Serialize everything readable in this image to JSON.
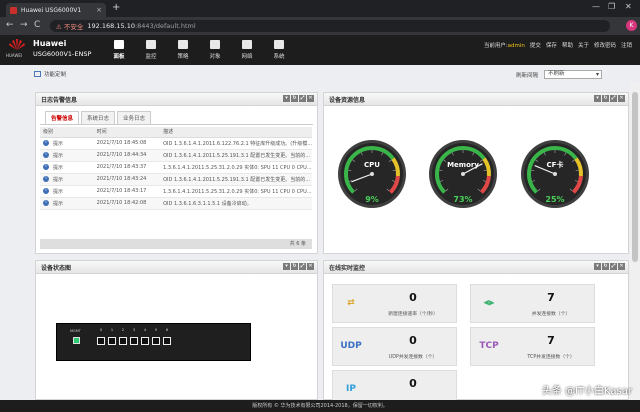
{
  "browser": {
    "tab_title": "Huawei USG6000V1",
    "tab_close": "×",
    "new_tab": "+",
    "window_controls": [
      "—",
      "❐",
      "✕"
    ],
    "nav": [
      "←",
      "→",
      "C"
    ],
    "security_warning": "⚠ 不安全",
    "url_host": "192.168.15.10",
    "url_rest": ":8443/default.html",
    "profile_initial": "K"
  },
  "header": {
    "brand": "HUAWEI",
    "title": "Huawei",
    "subtitle": "USG6000V1-ENSP",
    "nav": [
      "面板",
      "监控",
      "策略",
      "对象",
      "网络",
      "系统"
    ],
    "active_nav": 0,
    "user_prefix": "当前用户:",
    "user": "admin",
    "links": [
      "提交",
      "保存",
      "帮助",
      "关于",
      "修改密码",
      "注销"
    ]
  },
  "toolbar": {
    "customize": "功能定制",
    "refresh_label": "刷新间隔",
    "refresh_value": "不刷新"
  },
  "log_panel": {
    "title": "日志告警信息",
    "tabs": [
      "告警信息",
      "系统日志",
      "业务日志"
    ],
    "columns": [
      "级别",
      "时间",
      "描述"
    ],
    "level_icon": "i",
    "rows": [
      {
        "level": "提示",
        "time": "2021/7/10 18:45:08",
        "desc": "OID 1.3.6.1.4.1.2011.6.122.76.2.1 特征库升级成功。(升级模..."
      },
      {
        "level": "提示",
        "time": "2021/7/10 18:44:34",
        "desc": "OID 1.3.6.1.4.1.2011.5.25.191.3.1 配置已发生变更。当前的..."
      },
      {
        "level": "提示",
        "time": "2021/7/10 18:43:37",
        "desc": "1.3.6.1.4.1.2011.5.25.31.2.0.29 实体0: SPU 11 CPU 0 CPU..."
      },
      {
        "level": "提示",
        "time": "2021/7/10 18:43:24",
        "desc": "OID 1.3.6.1.4.1.2011.5.25.191.3.1 配置已发生变更。当前的..."
      },
      {
        "level": "提示",
        "time": "2021/7/10 18:43:17",
        "desc": "1.3.6.1.4.1.2011.5.25.31.2.0.29 实体0: SPU 11 CPU 0 CPU..."
      },
      {
        "level": "提示",
        "time": "2021/7/10 18:42:08",
        "desc": "OID 1.3.6.1.6.3.1.1.5.1 设备冷启动。"
      }
    ],
    "footer": "共 6 条"
  },
  "resource_panel": {
    "title": "设备资源信息",
    "gauges": [
      {
        "label": "CPU",
        "value": 9,
        "display": "9%"
      },
      {
        "label": "Memory",
        "value": 73,
        "display": "73%"
      },
      {
        "label": "CF卡",
        "value": 25,
        "display": "25%"
      }
    ]
  },
  "device_panel": {
    "title": "设备状态图",
    "device_label": "MGMT",
    "ports": [
      "0",
      "1",
      "2",
      "3",
      "4",
      "5",
      "6"
    ]
  },
  "monitor_panel": {
    "title": "在线实时监控",
    "tiles": [
      {
        "icon": "⇄",
        "value": "0",
        "label": "新建连接速率（个/秒）",
        "color": "#d9a72a"
      },
      {
        "icon": "⫷⫸",
        "value": "7",
        "label": "并发连接数（个）",
        "color": "#3cb371"
      },
      {
        "icon": "UDP",
        "value": "0",
        "label": "UDP并发连接数（个）",
        "color": "#3a6fc4"
      },
      {
        "icon": "TCP",
        "value": "7",
        "label": "TCP并发连接数（个）",
        "color": "#9b59b6"
      },
      {
        "icon": "IP",
        "value": "0",
        "label": "",
        "color": "#2e9fd8"
      }
    ]
  },
  "panel_controls": [
    "▾",
    "↻",
    "⤢",
    "✕"
  ],
  "footer": "版权所有 © 华为技术有限公司2014-2018，保留一切权利。",
  "watermark": "头条 @IT小白Kasar"
}
